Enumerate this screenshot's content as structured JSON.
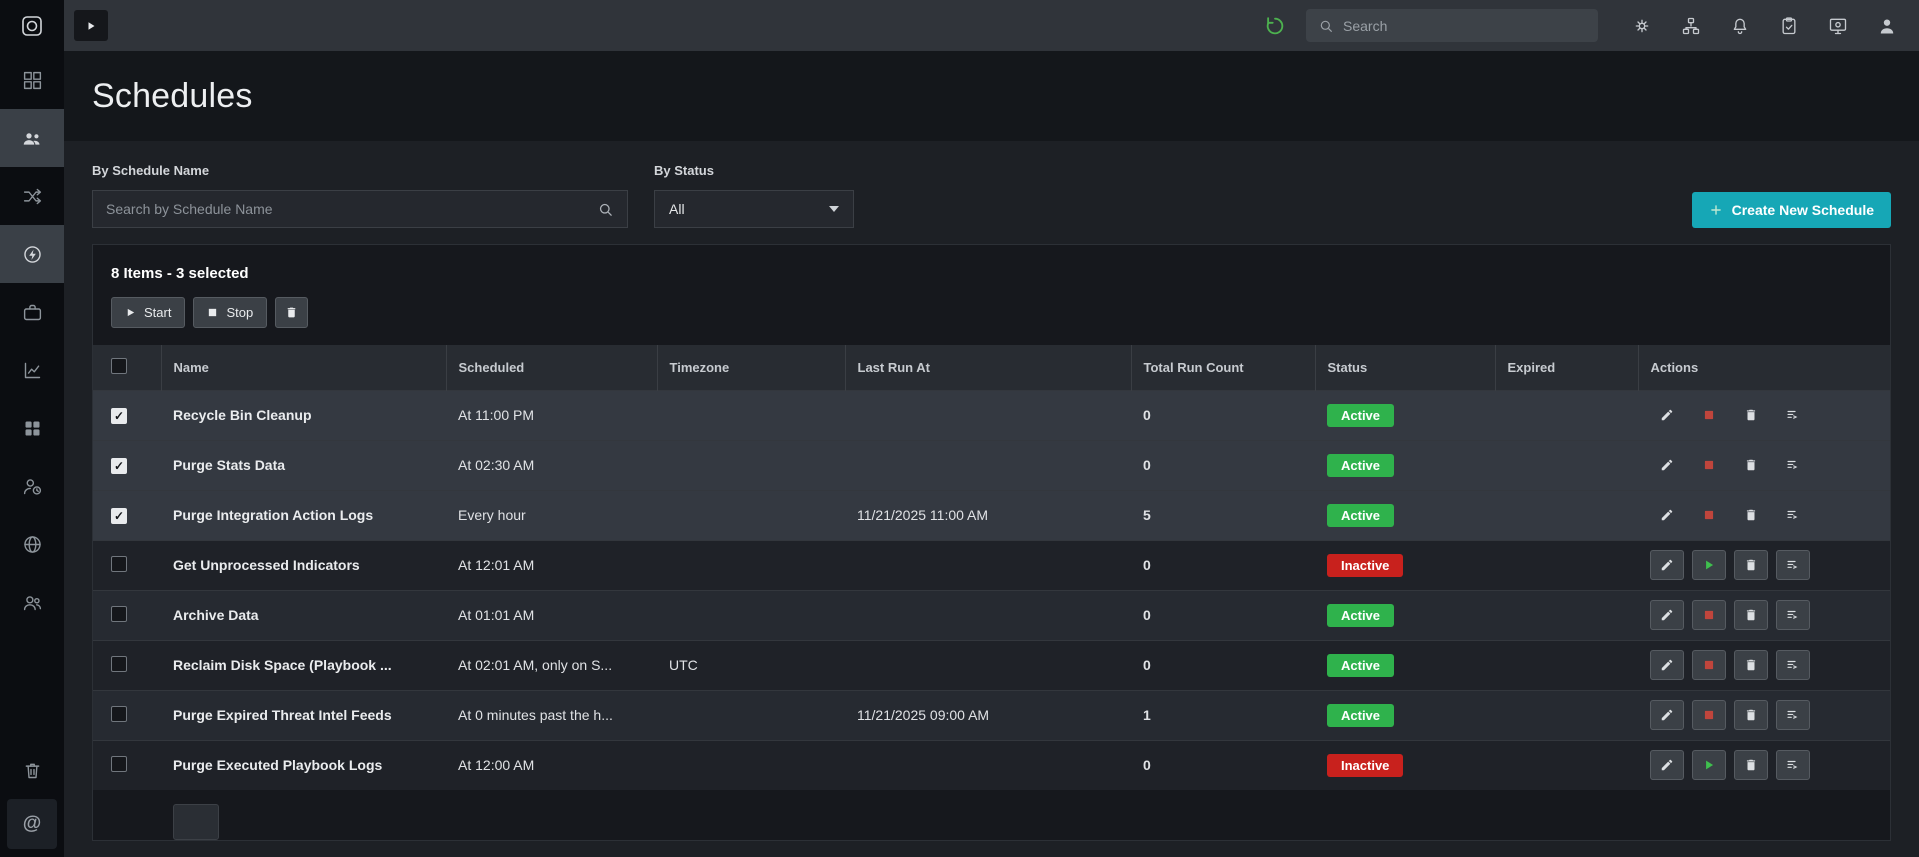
{
  "topbar": {
    "search_placeholder": "Search",
    "icons": [
      "sidebar-toggle-icon",
      "health-status-icon",
      "search-icon",
      "settings-gear-icon",
      "sitemap-icon",
      "notifications-bell-icon",
      "tasks-clipboard-icon",
      "system-monitor-icon",
      "user-profile-icon"
    ]
  },
  "sidebar": {
    "icons": [
      "app-logo",
      "dashboard-icon",
      "queues-icon",
      "shuffle-icon",
      "automation-icon",
      "briefcase-icon",
      "reports-icon",
      "apps-grid-icon",
      "user-clock-icon",
      "globe-icon",
      "team-icon",
      "recycle-bin-icon",
      "mentions-icon"
    ]
  },
  "page": {
    "title": "Schedules"
  },
  "filters": {
    "name_label": "By Schedule Name",
    "name_placeholder": "Search by Schedule Name",
    "status_label": "By Status",
    "status_value": "All"
  },
  "create": {
    "label": "Create New Schedule"
  },
  "toolbar": {
    "summary": "8 Items - 3 selected",
    "start_label": "Start",
    "stop_label": "Stop"
  },
  "table": {
    "headers": [
      "Name",
      "Scheduled",
      "Timezone",
      "Last Run At",
      "Total Run Count",
      "Status",
      "Expired",
      "Actions"
    ],
    "rows": [
      {
        "name": "Recycle Bin Cleanup",
        "scheduled": "At 11:00 PM",
        "timezone": "",
        "last_run_at": "",
        "total_run_count": "0",
        "status": "Active",
        "expired": "",
        "selected": true
      },
      {
        "name": "Purge Stats Data",
        "scheduled": "At 02:30 AM",
        "timezone": "",
        "last_run_at": "",
        "total_run_count": "0",
        "status": "Active",
        "expired": "",
        "selected": true
      },
      {
        "name": "Purge Integration Action Logs",
        "scheduled": "Every hour",
        "timezone": "",
        "last_run_at": "11/21/2025 11:00 AM",
        "total_run_count": "5",
        "status": "Active",
        "expired": "",
        "selected": true
      },
      {
        "name": "Get Unprocessed Indicators",
        "scheduled": "At 12:01 AM",
        "timezone": "",
        "last_run_at": "",
        "total_run_count": "0",
        "status": "Inactive",
        "expired": "",
        "selected": false
      },
      {
        "name": "Archive Data",
        "scheduled": "At 01:01 AM",
        "timezone": "",
        "last_run_at": "",
        "total_run_count": "0",
        "status": "Active",
        "expired": "",
        "selected": false
      },
      {
        "name": "Reclaim Disk Space (Playbook ...",
        "scheduled": "At 02:01 AM, only on S...",
        "timezone": "UTC",
        "last_run_at": "",
        "total_run_count": "0",
        "status": "Active",
        "expired": "",
        "selected": false
      },
      {
        "name": "Purge Expired Threat Intel Feeds",
        "scheduled": "At 0 minutes past the h...",
        "timezone": "",
        "last_run_at": "11/21/2025 09:00 AM",
        "total_run_count": "1",
        "status": "Active",
        "expired": "",
        "selected": false
      },
      {
        "name": "Purge Executed Playbook Logs",
        "scheduled": "At 12:00 AM",
        "timezone": "",
        "last_run_at": "",
        "total_run_count": "0",
        "status": "Inactive",
        "expired": "",
        "selected": false
      }
    ]
  },
  "colors": {
    "accent_teal": "#16a7b6",
    "active_green": "#2fb24c",
    "inactive_red": "#c8211d",
    "selected_row": "#343941"
  }
}
